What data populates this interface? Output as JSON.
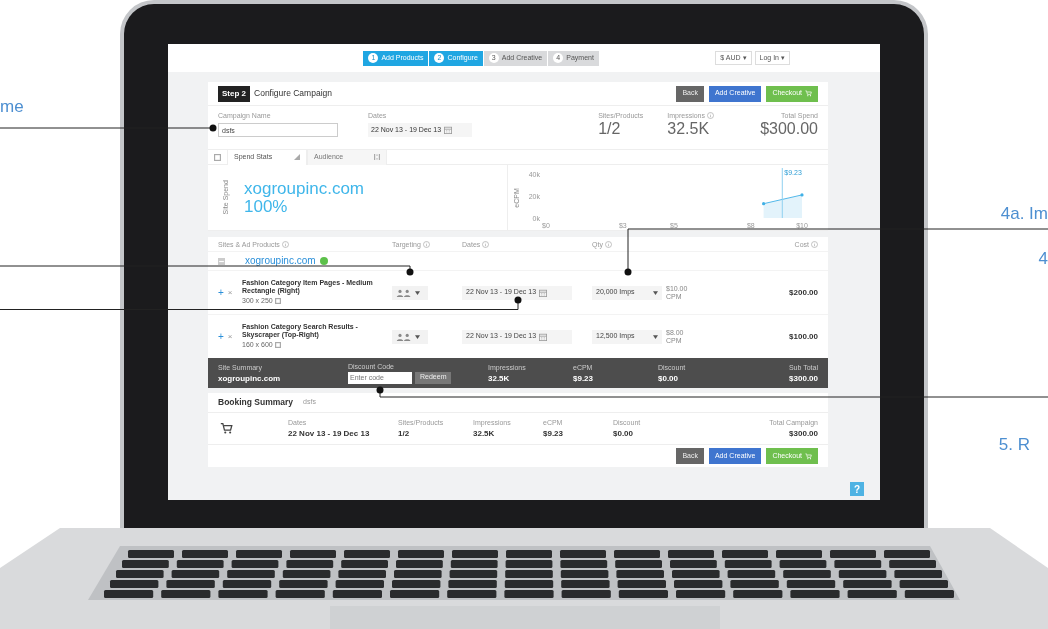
{
  "annotations": [
    {
      "text": "me"
    },
    {
      "text": "4a. Im"
    },
    {
      "text": "4"
    },
    {
      "text": "5. R"
    }
  ],
  "top_bar": {
    "steps": [
      {
        "number": "1",
        "label": "Add Products",
        "selected": true
      },
      {
        "number": "2",
        "label": "Configure",
        "selected": true
      },
      {
        "number": "3",
        "label": "Add Creative",
        "selected": false
      },
      {
        "number": "4",
        "label": "Payment",
        "selected": false
      }
    ],
    "currency": "$ AUD",
    "currency_caret": "▾",
    "login": "Log In",
    "login_caret": "▾"
  },
  "header": {
    "step_badge": "Step 2",
    "title": "Configure Campaign",
    "buttons": [
      {
        "label": "Back",
        "kind": "back"
      },
      {
        "label": "Add Creative",
        "kind": "primary"
      },
      {
        "label": "Checkout",
        "kind": "checkout"
      }
    ]
  },
  "campaign": {
    "name_label": "Campaign Name",
    "name_value": "dsfs",
    "dates_label": "Dates",
    "dates_value": "22 Nov 13 - 19 Dec 13",
    "stats": [
      {
        "label": "Sites/Products",
        "value": "1/2",
        "info": false
      },
      {
        "label": "Impressions",
        "value": "32.5K",
        "info": true
      },
      {
        "label": "Total Spend",
        "value": "$300.00",
        "info": false
      }
    ]
  },
  "stats_tabs": [
    {
      "label": "Spend Stats",
      "selected": true
    },
    {
      "label": "Audience",
      "selected": false
    }
  ],
  "site_spend": {
    "axis_label": "Site Spend",
    "site": "xogroupinc.com",
    "share": "100%"
  },
  "chart": {
    "chart_data": {
      "type": "line",
      "ylabel": "eCPM",
      "x": [
        8.5,
        10
      ],
      "xlim": [
        0,
        10
      ],
      "ylim": [
        0,
        40
      ],
      "xticks": [
        {
          "value": 0,
          "label": "$0"
        },
        {
          "value": 3,
          "label": "$3"
        },
        {
          "value": 5,
          "label": "$5"
        },
        {
          "value": 8,
          "label": "$8"
        },
        {
          "value": 10,
          "label": "$10"
        }
      ],
      "yticks": [
        {
          "value": 0,
          "label": "0k"
        },
        {
          "value": 20,
          "label": "20k"
        },
        {
          "value": 40,
          "label": "40k"
        }
      ],
      "series": [
        {
          "color": "#3fb0e6",
          "values": [
            13,
            21
          ]
        }
      ],
      "ref_lines": [
        {
          "axis": "x",
          "value": 9.23,
          "label": "$9.23"
        }
      ]
    }
  },
  "products_table": {
    "columns": [
      "Sites & Ad Products",
      "Targeting",
      "Dates",
      "Qty",
      "Cost"
    ],
    "site": "xogroupinc.com",
    "rows": [
      {
        "add": "+",
        "remove": "×",
        "name": "Fashion Category Item Pages - Medium Rectangle (Right)",
        "size": "300 x 250",
        "dates": "22 Nov 13 - 19 Dec 13",
        "qty": "20,000 Imps",
        "rate": "$10.00",
        "rate_unit": "CPM",
        "cost": "$200.00"
      },
      {
        "add": "+",
        "remove": "×",
        "name": "Fashion Category Search Results - Skyscraper (Top-Right)",
        "size": "160 x 600",
        "dates": "22 Nov 13 - 19 Dec 13",
        "qty": "12,500 Imps",
        "rate": "$8.00",
        "rate_unit": "CPM",
        "cost": "$100.00"
      }
    ]
  },
  "site_summary": {
    "site_label": "Site Summary",
    "site": "xogroupinc.com",
    "discount_label": "Discount Code",
    "discount_placeholder": "Enter code",
    "redeem": "Redeem",
    "metrics": [
      {
        "label": "Impressions",
        "value": "32.5K"
      },
      {
        "label": "eCPM",
        "value": "$9.23"
      },
      {
        "label": "Discount",
        "value": "$0.00"
      },
      {
        "label": "Sub Total",
        "value": "$300.00"
      }
    ]
  },
  "booking_summary": {
    "title": "Booking Summary",
    "campaign": "dsfs",
    "columns": [
      {
        "label": "Dates",
        "value": "22 Nov 13 - 19 Dec 13"
      },
      {
        "label": "Sites/Products",
        "value": "1/2"
      },
      {
        "label": "Impressions",
        "value": "32.5K"
      },
      {
        "label": "eCPM",
        "value": "$9.23"
      },
      {
        "label": "Discount",
        "value": "$0.00"
      },
      {
        "label": "Total Campaign",
        "value": "$300.00"
      }
    ]
  },
  "footer_buttons": [
    {
      "label": "Back",
      "kind": "back"
    },
    {
      "label": "Add Creative",
      "kind": "primary"
    },
    {
      "label": "Checkout",
      "kind": "checkout"
    }
  ],
  "help": "?"
}
